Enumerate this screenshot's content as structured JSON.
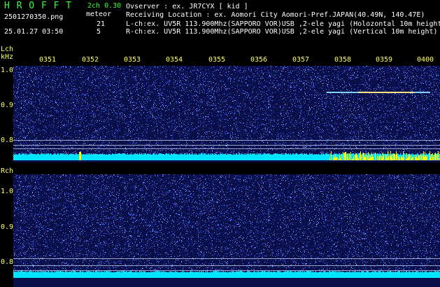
{
  "header": {
    "brand": "H R O F F T",
    "channel_label": "2ch 0.30",
    "meteor_label": "meteor",
    "count_l": "21",
    "count_r": "5",
    "filename": "2501270350.png",
    "datetime": "25.01.27 03:50",
    "observer_line": "Ovserver              : ex. JR7CYX [ kid ]",
    "location_line": "Receiving Location : ex. Aomori City Aomori-Pref.JAPAN(40.49N, 140.47E)",
    "lch_line": "L-ch:ex. UV5R 113.900Mhz(SAPPORO VOR)USB ,2-ele yagi (Holozontal 10m height",
    "rch_line": "R-ch:ex. UV5R 113.900Mhz(SAPPORO VOR)USB ,2-ele yagi (Vertical 10m height)"
  },
  "lch_panel": {
    "channel": "Lch",
    "unit": "kHz",
    "yticks": [
      "1.0",
      "0.9",
      "0.8"
    ],
    "times": [
      "0351",
      "0352",
      "0353",
      "0354",
      "0355",
      "0356",
      "0357",
      "0358",
      "0359",
      "0400"
    ]
  },
  "rch_panel": {
    "channel": "Rch",
    "yticks": [
      "1.0",
      "0.9",
      "0.8"
    ]
  },
  "colors": {
    "background": "#000000",
    "header_text": "#ffffff",
    "header_accent": "#33ff33",
    "label_yellow": "#ffff66",
    "noise_blue": "#1a2a8a",
    "baseline_cyan": "#00e5ff",
    "meteor_yellow": "#ffff00"
  }
}
